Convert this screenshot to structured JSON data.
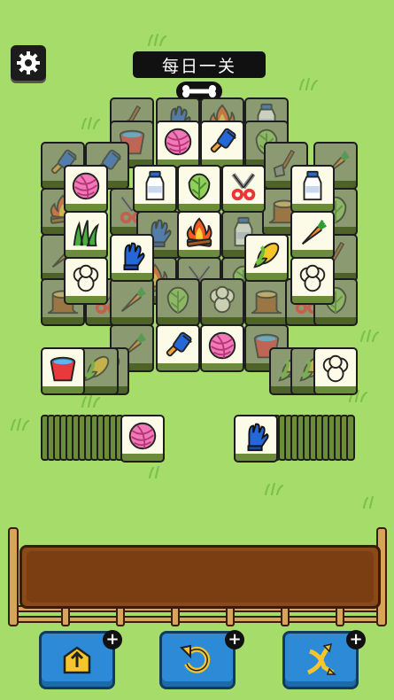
{
  "header": {
    "title": "每日一关"
  },
  "board": {
    "tile_icons": [
      "shovel",
      "blue-glove",
      "campfire",
      "water-bucket",
      "yarn-ball",
      "brush",
      "cabbage",
      "carrot",
      "milk-bottle",
      "shears",
      "grass",
      "corn",
      "cauliflower",
      "tree-stump"
    ]
  },
  "colors": {
    "background": "#a6dc6a",
    "tile_face": "#fbfbe8",
    "tile_side": "#6b8d3a",
    "button": "#2d8ad6",
    "tray": "#8a4a17"
  },
  "buttons": {
    "move_out": {
      "plus": "+"
    },
    "undo": {
      "plus": "+"
    },
    "shuffle": {
      "plus": "+"
    }
  }
}
